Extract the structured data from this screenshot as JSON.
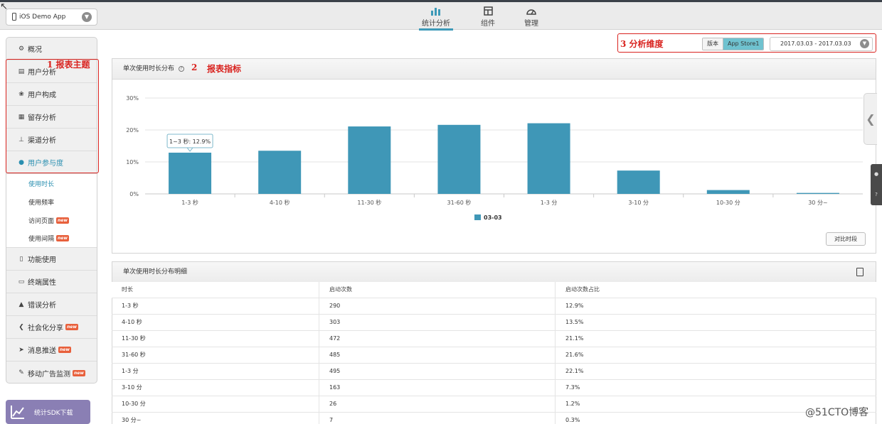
{
  "app_select": {
    "value": "iOS Demo App"
  },
  "nav": {
    "items": [
      {
        "label": "统计分析",
        "icon": "bar-chart-icon",
        "active": true
      },
      {
        "label": "组件",
        "icon": "grid-icon",
        "active": false
      },
      {
        "label": "管理",
        "icon": "gauge-icon",
        "active": false
      }
    ]
  },
  "sidebar": {
    "overview": "概况",
    "items": [
      {
        "label": "用户分析",
        "icon": "chart-icon"
      },
      {
        "label": "用户构成",
        "icon": "users-icon"
      },
      {
        "label": "留存分析",
        "icon": "retention-icon"
      },
      {
        "label": "渠道分析",
        "icon": "channel-icon"
      },
      {
        "label": "用户参与度",
        "icon": "user-icon"
      }
    ],
    "sub_items": [
      {
        "label": "使用时长",
        "active": true,
        "new": false
      },
      {
        "label": "使用频率",
        "active": false,
        "new": false
      },
      {
        "label": "访问页面",
        "active": false,
        "new": true
      },
      {
        "label": "使用间隔",
        "active": false,
        "new": true
      }
    ],
    "lower_items": [
      {
        "label": "功能使用",
        "icon": "feature-icon",
        "new": false
      },
      {
        "label": "终端属性",
        "icon": "device-icon",
        "new": false
      },
      {
        "label": "错误分析",
        "icon": "warning-icon",
        "new": false
      },
      {
        "label": "社会化分享",
        "icon": "share-icon",
        "new": true
      },
      {
        "label": "消息推送",
        "icon": "send-icon",
        "new": true
      },
      {
        "label": "移动广告监测",
        "icon": "ad-icon",
        "new": true
      }
    ],
    "new_badge": "new",
    "sdk_button": "统计SDK下载"
  },
  "annotations": {
    "report_subject": "1  报表主题",
    "report_metric": "报表指标",
    "metric_number": "2",
    "dimension": "3 分析维度"
  },
  "filters": {
    "version_label": "版本",
    "version_value": "App Store1",
    "date_range": "2017.03.03 - 2017.03.03"
  },
  "chart_panel": {
    "title": "单次使用时长分布",
    "compare_button": "对比时段"
  },
  "chart_data": {
    "type": "bar",
    "title": "单次使用时长分布",
    "categories": [
      "1-3 秒",
      "4-10 秒",
      "11-30 秒",
      "31-60 秒",
      "1-3 分",
      "3-10 分",
      "10-30 分",
      "30 分~"
    ],
    "series": [
      {
        "name": "03-03",
        "values": [
          12.9,
          13.5,
          21.1,
          21.6,
          22.1,
          7.3,
          1.2,
          0.3
        ],
        "color": "#3f97b7"
      }
    ],
    "y_ticks": [
      "0%",
      "10%",
      "20%",
      "30%"
    ],
    "ylim": [
      0,
      30
    ],
    "grid": true,
    "legend": "bottom-center",
    "tooltip": "1~3 秒: 12.9%"
  },
  "detail_table": {
    "title": "单次使用时长分布明细",
    "columns": [
      "时长",
      "启动次数",
      "启动次数占比"
    ],
    "rows": [
      [
        "1-3 秒",
        "290",
        "12.9%"
      ],
      [
        "4-10 秒",
        "303",
        "13.5%"
      ],
      [
        "11-30 秒",
        "472",
        "21.1%"
      ],
      [
        "31-60 秒",
        "485",
        "21.6%"
      ],
      [
        "1-3 分",
        "495",
        "22.1%"
      ],
      [
        "3-10 分",
        "163",
        "7.3%"
      ],
      [
        "10-30 分",
        "26",
        "1.2%"
      ],
      [
        "30 分~",
        "7",
        "0.3%"
      ]
    ]
  },
  "watermark": "@51CTO博客"
}
